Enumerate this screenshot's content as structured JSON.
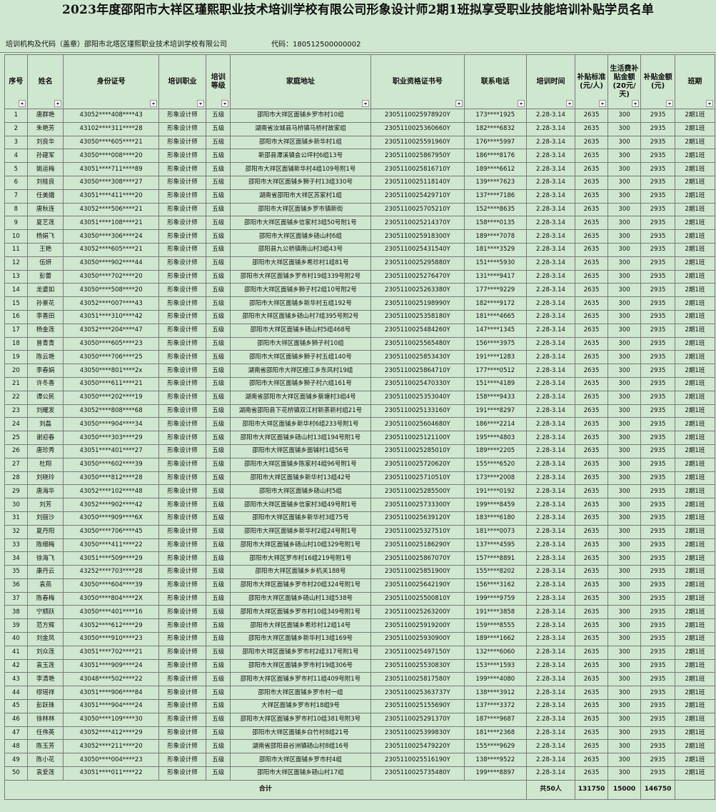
{
  "document": {
    "title": "2023年度邵阳市大祥区瑾熙职业技术培训学校有限公司形象设计师2期1班拟享受职业技能培训补贴学员名单",
    "org_label": "培训机构及代码（盖章）邵阳市北塔区瑾熙职业技术培训学校有限公司",
    "code_label": "代码：180512500000002"
  },
  "columns": [
    "序号",
    "姓名",
    "身份证号",
    "培训职业",
    "培训等级",
    "家庭地址",
    "职业资格证书号",
    "联系电话",
    "培训时间",
    "补贴标准(元/人)",
    "生活费补贴金额(20元/天)",
    "补贴金额(元)",
    "班期"
  ],
  "rows": [
    [
      "1",
      "唐群艳",
      "43052****408****43",
      "形象设计师",
      "五级",
      "邵阳市大祥区面铺乡罗市村10组",
      "2305110025978920Y",
      "173****1925",
      "2.28-3.14",
      "2635",
      "300",
      "2935",
      "2期1班"
    ],
    [
      "2",
      "朱艳芳",
      "43102****311****28",
      "形象设计师",
      "五级",
      "湖南省汝城县马桥镇马桥村故家组",
      "2305110025360660Y",
      "182****6832",
      "2.28-3.14",
      "2635",
      "300",
      "2935",
      "2期1班"
    ],
    [
      "3",
      "刘良华",
      "43050****605****21",
      "形象设计师",
      "五级",
      "邵阳市大祥区面铺乡新华村1组",
      "2305110025591960Y",
      "176****5997",
      "2.28-3.14",
      "2635",
      "300",
      "2935",
      "2期1班"
    ],
    [
      "4",
      "孙建军",
      "43050****008****20",
      "形象设计师",
      "五级",
      "新邵县潭溪镇会公坪村6组13号",
      "2305110025867950Y",
      "186****8176",
      "2.28-3.14",
      "2635",
      "300",
      "2935",
      "2期1班"
    ],
    [
      "5",
      "姚运梅",
      "43051****711****89",
      "形象设计师",
      "五级",
      "邵阳市大祥区面铺新华村4组109号附1号",
      "2305110025816710Y",
      "189****6612",
      "2.28-3.14",
      "2635",
      "300",
      "2935",
      "2期1班"
    ],
    [
      "6",
      "刘桂良",
      "43050****308****27",
      "形象设计师",
      "五级",
      "邵阳市大祥区面铺乡狮子村13组330号",
      "2305110025118140Y",
      "139****7623",
      "2.28-3.14",
      "2635",
      "300",
      "2935",
      "2期1班"
    ],
    [
      "7",
      "任美娥",
      "43051****411****20",
      "形象设计师",
      "五级",
      "湖南省邵阳市大祥区苏家村1组",
      "2305110025429710Y",
      "137****7186",
      "2.28-3.14",
      "2635",
      "300",
      "2935",
      "2期1班"
    ],
    [
      "8",
      "唐秋连",
      "43052****506****21",
      "形象设计师",
      "五级",
      "邵阳市大祥区面铺乡罗市镇新街",
      "2305110025705210Y",
      "152****8635",
      "2.28-3.14",
      "2635",
      "300",
      "2935",
      "2期1班"
    ],
    [
      "9",
      "夏艺莲",
      "43051****108****21",
      "形象设计师",
      "五级",
      "邵阳市大祥区面铺乡信家村3组50号附1号",
      "2305110025214370Y",
      "158****0135",
      "2.28-3.14",
      "2635",
      "300",
      "2935",
      "2期1班"
    ],
    [
      "10",
      "杨娟飞",
      "43050****306****24",
      "形象设计师",
      "五级",
      "邵阳市大祥区面铺乡砀山村6组",
      "2305110025918300Y",
      "189****7078",
      "2.28-3.14",
      "2635",
      "300",
      "2935",
      "2期1班"
    ],
    [
      "11",
      "王艳",
      "43052****605****21",
      "形象设计师",
      "五级",
      "邵阳县九公桥镇南山村3组43号",
      "2305110025431540Y",
      "181****3529",
      "2.28-3.14",
      "2635",
      "300",
      "2935",
      "2期1班"
    ],
    [
      "12",
      "伍妍",
      "43050****902****44",
      "形象设计师",
      "五级",
      "邵阳市大祥区面铺乡希珍村1组81号",
      "2305110025295880Y",
      "151****5930",
      "2.28-3.14",
      "2635",
      "300",
      "2935",
      "2期1班"
    ],
    [
      "13",
      "彭蕾",
      "43050****702****20",
      "形象设计师",
      "五级",
      "邵阳市大祥区面铺乡罗市村19组339号附2号",
      "2305110025276470Y",
      "131****9417",
      "2.28-3.14",
      "2635",
      "300",
      "2935",
      "2期1班"
    ],
    [
      "14",
      "龙婆如",
      "43050****508****20",
      "形象设计师",
      "五级",
      "邵阳市大祥区面铺乡狮子村2组10号附2号",
      "2305110025263380Y",
      "177****9229",
      "2.28-3.14",
      "2635",
      "300",
      "2935",
      "2期1班"
    ],
    [
      "15",
      "孙景花",
      "43052****007****43",
      "形象设计师",
      "五级",
      "邵阳市大祥区面铺乡新华村五组192号",
      "2305110025198990Y",
      "182****9172",
      "2.28-3.14",
      "2635",
      "300",
      "2935",
      "2期1班"
    ],
    [
      "16",
      "李香田",
      "43051****310****42",
      "形象设计师",
      "五级",
      "邵阳市大祥区面铺乡砀山村7组395号附2号",
      "2305110025358180Y",
      "181****4665",
      "2.28-3.14",
      "2635",
      "300",
      "2935",
      "2期1班"
    ],
    [
      "17",
      "杨金莲",
      "43052****204****47",
      "形象设计师",
      "五级",
      "邵阳市大祥区面铺乡砀山村5组468号",
      "2305110025484260Y",
      "147****1345",
      "2.28-3.14",
      "2635",
      "300",
      "2935",
      "2期1班"
    ],
    [
      "18",
      "曾青青",
      "43050****605****23",
      "形象设计师",
      "五级",
      "邵阳市大祥区面铺乡狮子村10组",
      "2305110025565480Y",
      "156****3975",
      "2.28-3.14",
      "2635",
      "300",
      "2935",
      "2期1班"
    ],
    [
      "19",
      "陈云艳",
      "43050****706****25",
      "形象设计师",
      "五级",
      "邵阳市大祥区面铺乡狮子村五组140号",
      "2305110025853430Y",
      "191****1283",
      "2.28-3.14",
      "2635",
      "300",
      "2935",
      "2期1班"
    ],
    [
      "20",
      "李春娟",
      "43050****801****2x",
      "形象设计师",
      "五级",
      "湖南省邵阳市大祥区檀江乡东风村19组",
      "2305110025864710Y",
      "177****0512",
      "2.28-3.14",
      "2635",
      "300",
      "2935",
      "2期1班"
    ],
    [
      "21",
      "许冬香",
      "43050****611****21",
      "形象设计师",
      "五级",
      "邵阳市大祥区面铺乡狮子村六组161号",
      "2305110025470330Y",
      "151****4189",
      "2.28-3.14",
      "2635",
      "300",
      "2935",
      "2期1班"
    ],
    [
      "22",
      "谭公民",
      "43050****202****19",
      "形象设计师",
      "五级",
      "湖南省邵阳市大祥区面铺乡蔡塘村3组4号",
      "2305110025353040Y",
      "158****9433",
      "2.28-3.14",
      "2635",
      "300",
      "2935",
      "2期1班"
    ],
    [
      "23",
      "刘耀发",
      "43052****808****68",
      "形象设计师",
      "五级",
      "湖南省邵阳县下花桥镇双江村新茶新村组21号",
      "2305110025133160Y",
      "191****8297",
      "2.28-3.14",
      "2635",
      "300",
      "2935",
      "2期1班"
    ],
    [
      "24",
      "刘磊",
      "43050****904****34",
      "形象设计师",
      "五级",
      "邵阳市大祥区面铺乡新华村6组233号附1号",
      "2305110025604680Y",
      "186****2214",
      "2.28-3.14",
      "2635",
      "300",
      "2935",
      "2期1班"
    ],
    [
      "25",
      "谢迎春",
      "43050****303****29",
      "形象设计师",
      "五级",
      "邵阳市大祥区面铺乡砀山村13组194号附1号",
      "2305110025121100Y",
      "195****4803",
      "2.28-3.14",
      "2635",
      "300",
      "2935",
      "2期1班"
    ],
    [
      "26",
      "唐珍秀",
      "43051****401****27",
      "形象设计师",
      "五级",
      "邵阳市大祥区面铺乡面铺村1组56号",
      "2305110025285010Y",
      "189****2205",
      "2.28-3.14",
      "2635",
      "300",
      "2935",
      "2期1班"
    ],
    [
      "27",
      "杜翔",
      "43050****602****39",
      "形象设计师",
      "五级",
      "邵阳市大祥区面铺乡陈家村4组96号附1号",
      "2305110025720620Y",
      "155****6520",
      "2.28-3.14",
      "2635",
      "300",
      "2935",
      "2期1班"
    ],
    [
      "28",
      "刘晓玲",
      "43050****812****28",
      "形象设计师",
      "五级",
      "邵阳市大祥区面铺乡新华村13组42号",
      "2305110025710510Y",
      "173****2008",
      "2.28-3.14",
      "2635",
      "300",
      "2935",
      "2期1班"
    ],
    [
      "29",
      "唐海华",
      "43052****102****48",
      "形象设计师",
      "五级",
      "邵阳市大祥区面铺乡砀山村5组",
      "2305110025285500Y",
      "191****0192",
      "2.28-3.14",
      "2635",
      "300",
      "2935",
      "2期1班"
    ],
    [
      "30",
      "刘芳",
      "43052****902****42",
      "形象设计师",
      "五级",
      "邵阳市大祥区面铺乡信家村3组49号附1号",
      "2305110025733300Y",
      "199****8459",
      "2.28-3.14",
      "2635",
      "300",
      "2935",
      "2期1班"
    ],
    [
      "31",
      "刘丽沙",
      "43050****909****6X",
      "形象设计师",
      "五级",
      "邵阳市大祥区面铺乡新华村3组75号",
      "2305110025639120Y",
      "183****6180",
      "2.28-3.14",
      "2635",
      "300",
      "2935",
      "2期1班"
    ],
    [
      "32",
      "夏丹阳",
      "43050****706****45",
      "形象设计师",
      "五级",
      "邵阳市大祥区面铺乡新华村2组24号附1号",
      "2305110025327510Y",
      "181****0073",
      "2.28-3.14",
      "2635",
      "300",
      "2935",
      "2期1班"
    ],
    [
      "33",
      "陈细梅",
      "43050****411****22",
      "形象设计师",
      "五级",
      "邵阳市大祥区面铺乡砀山村10组329号附1号",
      "2305110025186290Y",
      "137****4595",
      "2.28-3.14",
      "2635",
      "300",
      "2935",
      "2期1班"
    ],
    [
      "34",
      "徐海飞",
      "43051****509****29",
      "形象设计师",
      "五级",
      "邵阳市大祥区罗市村16组219号附1号",
      "2305110025867070Y",
      "157****8891",
      "2.28-3.14",
      "2635",
      "300",
      "2935",
      "2期1班"
    ],
    [
      "35",
      "康丹云",
      "43252****703****28",
      "形象设计师",
      "五级",
      "邵阳市大祥区面铺乡乡机关188号",
      "2305110025851900Y",
      "155****8202",
      "2.28-3.14",
      "2635",
      "300",
      "2935",
      "2期1班"
    ],
    [
      "36",
      "袁燕",
      "43050****604****39",
      "形象设计师",
      "五级",
      "邵阳市大祥区面铺乡罗市村20组324号附1号",
      "2305110025642190Y",
      "156****3162",
      "2.28-3.14",
      "2635",
      "300",
      "2935",
      "2期1班"
    ],
    [
      "37",
      "陈春梅",
      "43050****804****2X",
      "形象设计师",
      "五级",
      "邵阳市大祥区面铺乡砀山村13组538号",
      "2305110025500810Y",
      "199****9759",
      "2.28-3.14",
      "2635",
      "300",
      "2935",
      "2期1班"
    ],
    [
      "38",
      "宁顺跃",
      "43050****401****16",
      "形象设计师",
      "五级",
      "邵阳市大祥区面铺乡罗市村10组349号附1号",
      "2305110025263200Y",
      "191****3858",
      "2.28-3.14",
      "2635",
      "300",
      "2935",
      "2期1班"
    ],
    [
      "39",
      "范方辉",
      "43052****612****29",
      "形象设计师",
      "五级",
      "邵阳市大祥区面铺乡希珍村12组14号",
      "2305110025919200Y",
      "159****8555",
      "2.28-3.14",
      "2635",
      "300",
      "2935",
      "2期1班"
    ],
    [
      "40",
      "刘金凤",
      "43050****910****23",
      "形象设计师",
      "五级",
      "邵阳市大祥区面铺乡新华村13组169号",
      "2305110025930900Y",
      "189****1662",
      "2.28-3.14",
      "2635",
      "300",
      "2935",
      "2期1班"
    ],
    [
      "41",
      "刘众莲",
      "43051****702****21",
      "形象设计师",
      "五级",
      "邵阳市大祥区面铺乡罗市村2组317号附1号",
      "2305110025497150Y",
      "132****6060",
      "2.28-3.14",
      "2635",
      "300",
      "2935",
      "2期1班"
    ],
    [
      "42",
      "袁玉莲",
      "43051****909****24",
      "形象设计师",
      "五级",
      "邵阳市大祥区面铺乡罗市村19组306号",
      "2305110025530830Y",
      "153****1593",
      "2.28-3.14",
      "2635",
      "300",
      "2935",
      "2期1班"
    ],
    [
      "43",
      "李清艳",
      "43048****502****22",
      "形象设计师",
      "五级",
      "邵阳市大祥区面铺乡罗市村11组409号附1号",
      "2305110025817580Y",
      "199****4080",
      "2.28-3.14",
      "2635",
      "300",
      "2935",
      "2期1班"
    ],
    [
      "44",
      "缪瑶祥",
      "43051****906****84",
      "形象设计师",
      "五级",
      "邵阳市大祥区面铺乡罗市村一组",
      "2305110025363737Y",
      "138****3912",
      "2.28-3.14",
      "2635",
      "300",
      "2935",
      "2期1班"
    ],
    [
      "45",
      "彭跃珠",
      "43051****904****24",
      "形象设计师",
      "五级",
      "大祥区面铺乡罗市村18组9号",
      "2305110025155690Y",
      "137****3372",
      "2.28-3.14",
      "2635",
      "300",
      "2935",
      "2期1班"
    ],
    [
      "46",
      "徐林林",
      "43050****109****30",
      "形象设计师",
      "五级",
      "邵阳市大祥区面铺乡罗市村10组381号附3号",
      "2305110025291370Y",
      "187****9687",
      "2.28-3.14",
      "2635",
      "300",
      "2935",
      "2期1班"
    ],
    [
      "47",
      "任伟英",
      "43052****412****29",
      "形象设计师",
      "五级",
      "邵阳市大祥区面铺乡白竹村8组21号",
      "2305110025399830Y",
      "181****2368",
      "2.28-3.14",
      "2635",
      "300",
      "2935",
      "2期1班"
    ],
    [
      "48",
      "陈玉芳",
      "43052****211****20",
      "形象设计师",
      "五级",
      "湖南省邵阳县谷洲镇砀山村8组16号",
      "2305110025479220Y",
      "155****9629",
      "2.28-3.14",
      "2635",
      "300",
      "2935",
      "2期1班"
    ],
    [
      "49",
      "陈小花",
      "43050****004****23",
      "形象设计师",
      "五级",
      "邵阳市大祥区面铺乡罗市村4组",
      "2305110025516190Y",
      "138****9522",
      "2.28-3.14",
      "2635",
      "300",
      "2935",
      "2期1班"
    ],
    [
      "50",
      "袁爱莲",
      "43051****011****22",
      "形象设计师",
      "五级",
      "邵阳市大祥区面铺乡砀山村17组",
      "2305110025735480Y",
      "199****8897",
      "2.28-3.14",
      "2635",
      "300",
      "2935",
      "2期1班"
    ]
  ],
  "totals": {
    "label": "合计",
    "count": "共50人",
    "subsidy": "131750",
    "living": "15000",
    "amount": "146750"
  }
}
